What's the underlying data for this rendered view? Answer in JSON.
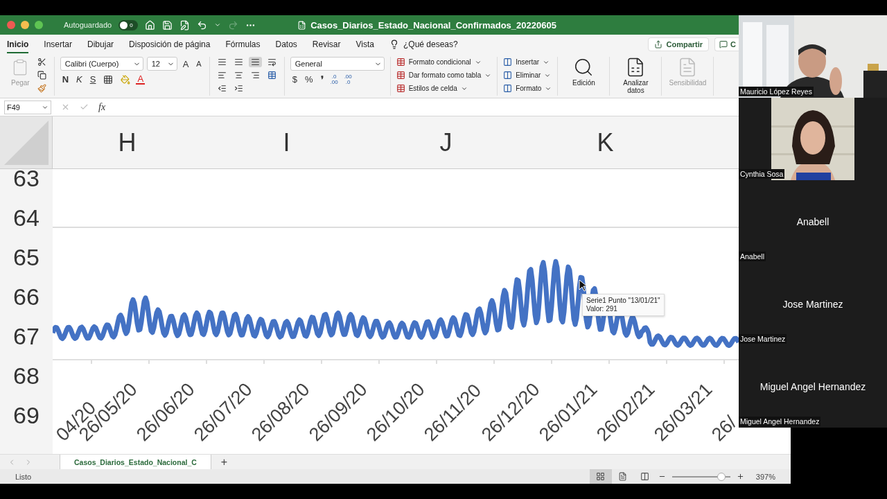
{
  "titlebar": {
    "autosave": {
      "label": "Autoguardado",
      "on": false,
      "state_text": "0"
    },
    "redo_disabled": true,
    "file_title": "Casos_Diarios_Estado_Nacional_Confirmados_20220605"
  },
  "ribbon_tabs": [
    {
      "label": "Inicio",
      "selected": true
    },
    {
      "label": "Insertar",
      "selected": false
    },
    {
      "label": "Dibujar",
      "selected": false
    },
    {
      "label": "Disposición de página",
      "selected": false
    },
    {
      "label": "Fórmulas",
      "selected": false
    },
    {
      "label": "Datos",
      "selected": false
    },
    {
      "label": "Revisar",
      "selected": false
    },
    {
      "label": "Vista",
      "selected": false
    }
  ],
  "tell_me": "¿Qué deseas?",
  "share_button": "Compartir",
  "comments_button": "C",
  "ribbon": {
    "paste": {
      "label": "Pegar",
      "disabled": true
    },
    "font": {
      "name": "Calibri (Cuerpo)",
      "size": "12"
    },
    "font_size_buttons": [
      "A",
      "A"
    ],
    "text_style_buttons": [
      "N",
      "K",
      "S"
    ],
    "font_color_button": "A",
    "alignment": [
      {
        "selected": false
      },
      {
        "selected": false
      },
      {
        "selected": true
      }
    ],
    "number_format": "General",
    "number_symbols": [
      "$",
      "%",
      "❜"
    ],
    "decimal_buttons": [
      {
        "lines": [
          ".0",
          ".00"
        ]
      },
      {
        "lines": [
          ".00",
          ".0"
        ]
      }
    ],
    "styles": [
      "Formato condicional",
      "Dar formato como tabla",
      "Estilos de celda"
    ],
    "cells": [
      "Insertar",
      "Eliminar",
      "Formato"
    ],
    "big_buttons": [
      {
        "kind": "search",
        "label": "Edición",
        "disabled": false
      },
      {
        "kind": "analyze",
        "label": "Analizar datos",
        "disabled": false
      },
      {
        "kind": "sensitivity",
        "label": "Sensibilidad",
        "disabled": true
      }
    ]
  },
  "formula_bar": {
    "name_box": "F49",
    "fx": "fx"
  },
  "sheet": {
    "columns": [
      "H",
      "I",
      "J",
      "K"
    ],
    "rows": [
      "63",
      "64",
      "65",
      "66",
      "67",
      "68",
      "69"
    ]
  },
  "chart": {
    "x_labels": [
      "04/20",
      "26/05/20",
      "26/06/20",
      "26/07/20",
      "26/08/20",
      "26/09/20",
      "26/10/20",
      "26/11/20",
      "26/12/20",
      "26/01/21",
      "26/02/21",
      "26/03/21",
      "26/"
    ],
    "tooltip": {
      "title": "Serie1 Punto \"13/01/21\"",
      "value": "Valor: 291"
    }
  },
  "sheet_tabs": [
    {
      "label": "Casos_Diarios_Estado_Nacional_C",
      "selected": true
    }
  ],
  "add_sheet": "+",
  "status_bar": {
    "text": "Listo",
    "views": [
      {
        "selected": true
      },
      {
        "selected": false
      },
      {
        "selected": false
      }
    ],
    "zoom": {
      "level": 0.92,
      "text": "397%"
    }
  },
  "participants": [
    {
      "kind": "video",
      "label": "Mauricio López Reyes"
    },
    {
      "kind": "video",
      "label": "Cynthia Sosa"
    },
    {
      "kind": "name",
      "center_name": "Anabell",
      "label": "Anabell"
    },
    {
      "kind": "name",
      "center_name": "Jose Martinez",
      "label": "Jose Martinez"
    },
    {
      "kind": "name",
      "center_name": "Miguel Angel Hernandez",
      "label": "Miguel Angel Hernandez"
    }
  ]
}
